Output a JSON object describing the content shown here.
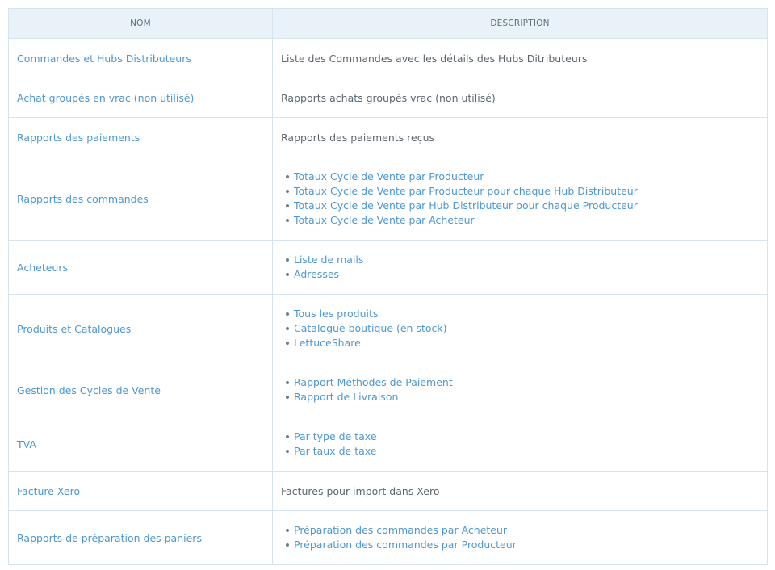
{
  "headers": {
    "name": "NOM",
    "description": "DESCRIPTION"
  },
  "rows": [
    {
      "name": "Commandes et Hubs Distributeurs",
      "description": "Liste des Commandes avec les détails des Hubs Ditributeurs"
    },
    {
      "name": "Achat groupés en vrac (non utilisé)",
      "description": "Rapports achats groupés vrac (non utilisé)"
    },
    {
      "name": "Rapports des paiements",
      "description": "Rapports des paiements reçus"
    },
    {
      "name": "Rapports des commandes",
      "items": [
        "Totaux Cycle de Vente par Producteur",
        "Totaux Cycle de Vente par Producteur pour chaque Hub Distributeur",
        "Totaux Cycle de Vente par Hub Distributeur pour chaque Producteur",
        "Totaux Cycle de Vente par Acheteur"
      ]
    },
    {
      "name": "Acheteurs",
      "items": [
        "Liste de mails",
        "Adresses"
      ]
    },
    {
      "name": "Produits et Catalogues",
      "items": [
        "Tous les produits",
        "Catalogue boutique (en stock)",
        "LettuceShare"
      ]
    },
    {
      "name": "Gestion des Cycles de Vente",
      "items": [
        "Rapport Méthodes de Paiement",
        "Rapport de Livraison"
      ]
    },
    {
      "name": "TVA",
      "items": [
        "Par type de taxe",
        "Par taux de taxe"
      ]
    },
    {
      "name": "Facture Xero",
      "description": "Factures pour import dans Xero"
    },
    {
      "name": "Rapports de préparation des paniers",
      "items": [
        "Préparation des commandes par Acheteur",
        "Préparation des commandes par Producteur"
      ]
    }
  ]
}
